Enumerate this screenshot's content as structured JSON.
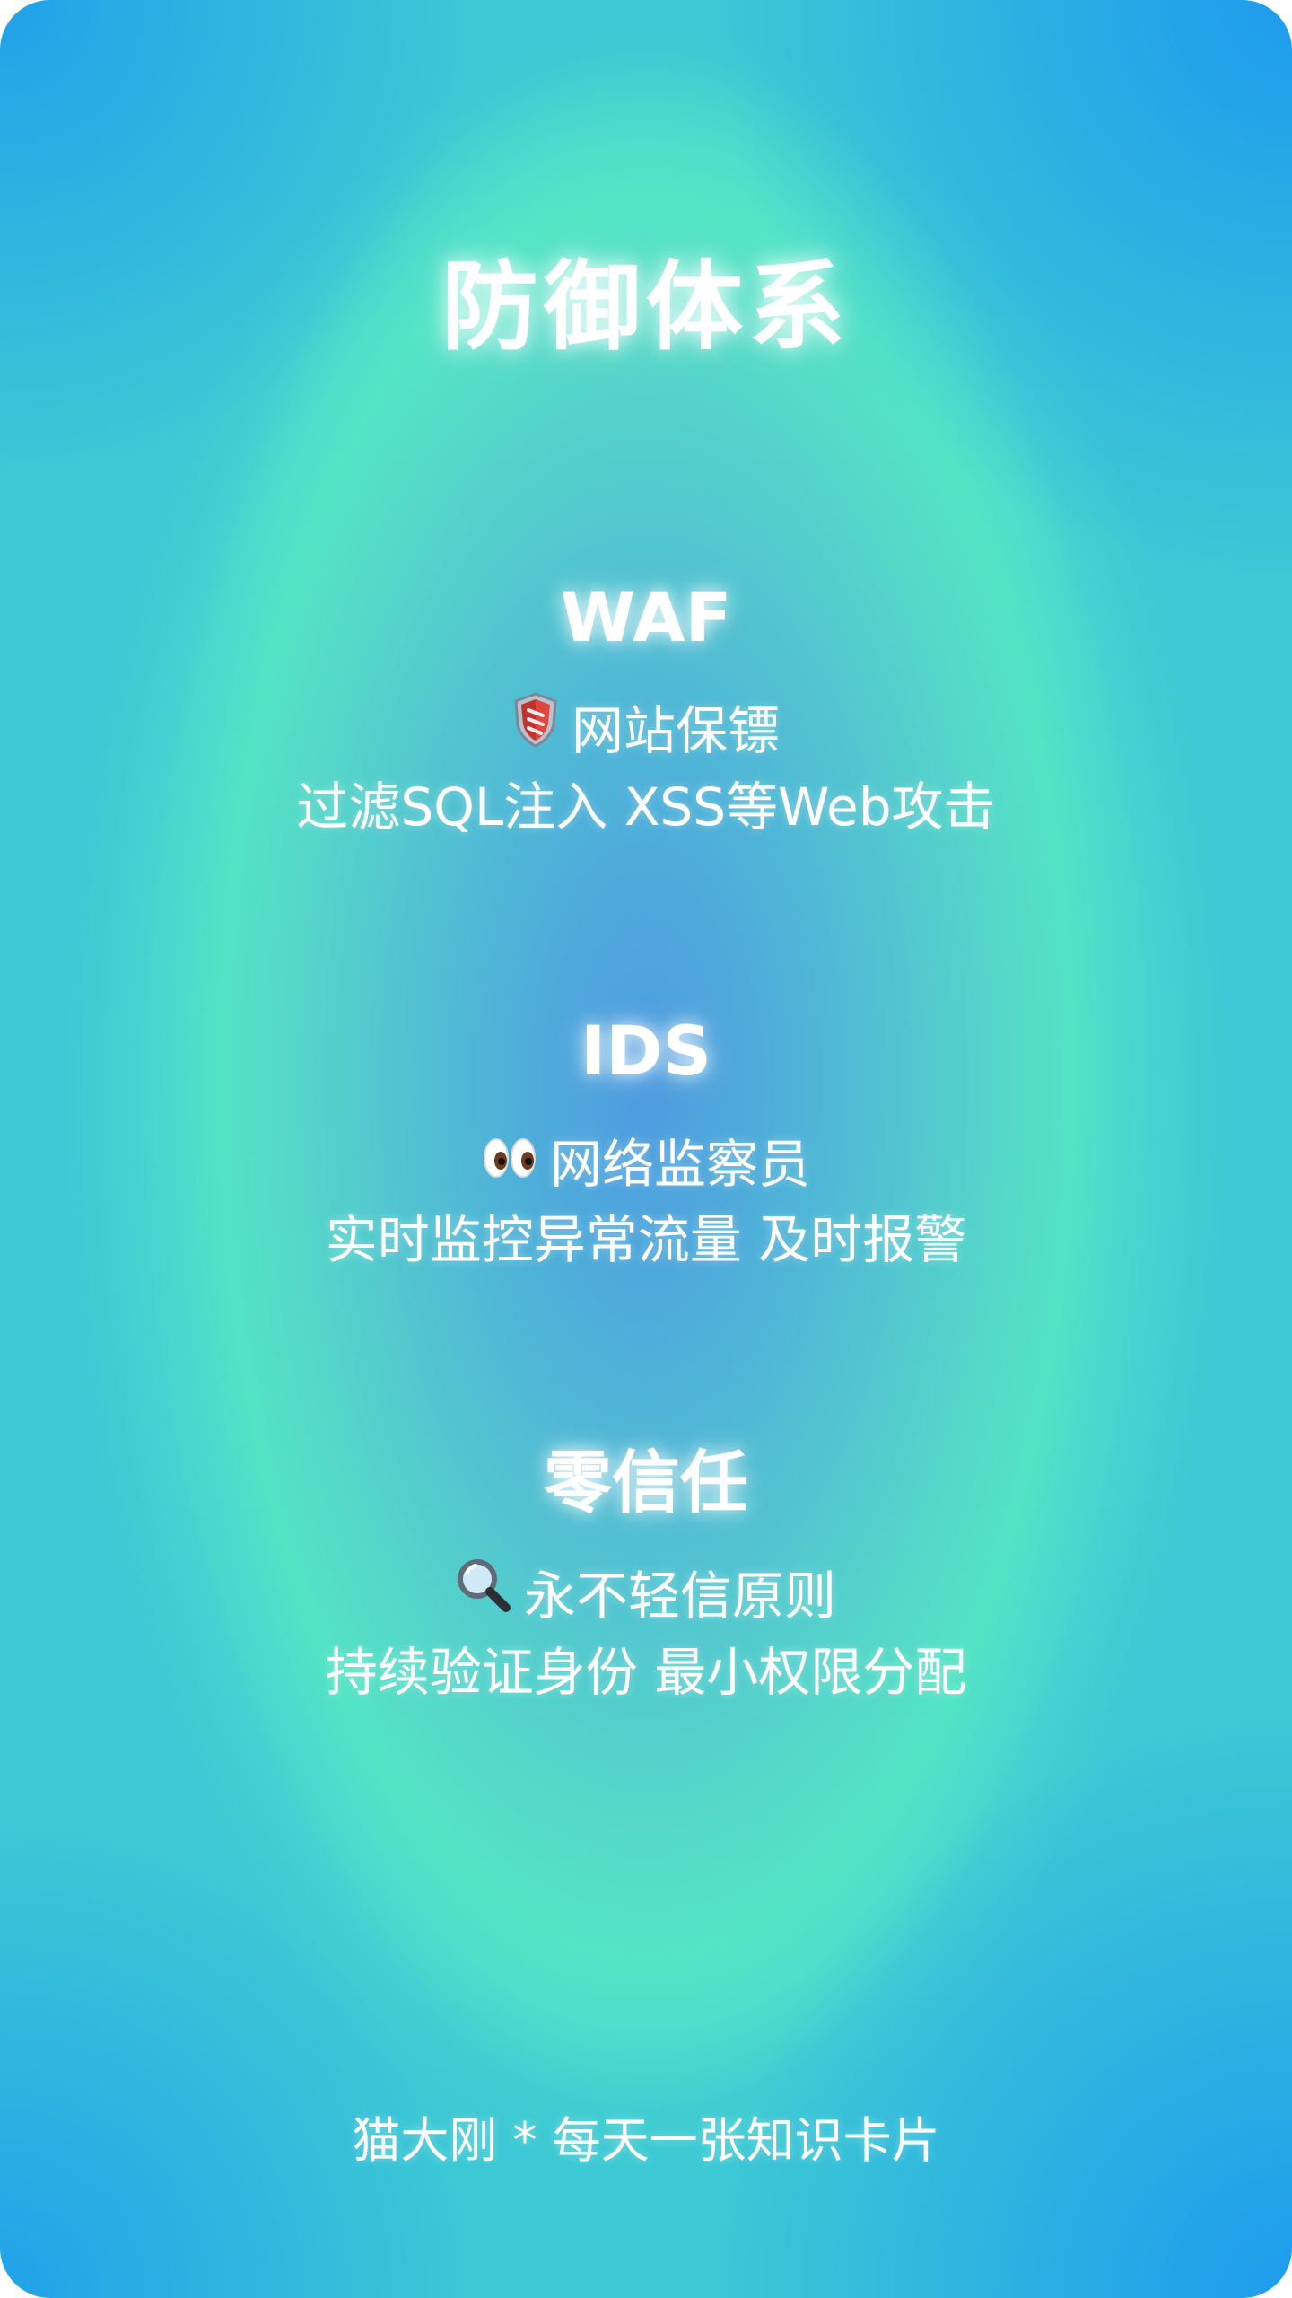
{
  "card": {
    "title": "防御体系",
    "sections": [
      {
        "heading": "WAF",
        "icon": "shield-icon",
        "subtitle": "网站保镖",
        "description": "过滤SQL注入 XSS等Web攻击"
      },
      {
        "heading": "IDS",
        "icon": "eyes-icon",
        "subtitle": "网络监察员",
        "description": "实时监控异常流量 及时报警"
      },
      {
        "heading": "零信任",
        "icon": "magnifier-icon",
        "subtitle": "永不轻信原则",
        "description": "持续验证身份 最小权限分配"
      }
    ],
    "footer": "猫大刚 * 每天一张知识卡片"
  },
  "colors": {
    "edge_blue": "#1e9ff0",
    "mint_glow": "#52e3c4",
    "center_blue": "#4e9be0",
    "text": "#ffffff"
  }
}
